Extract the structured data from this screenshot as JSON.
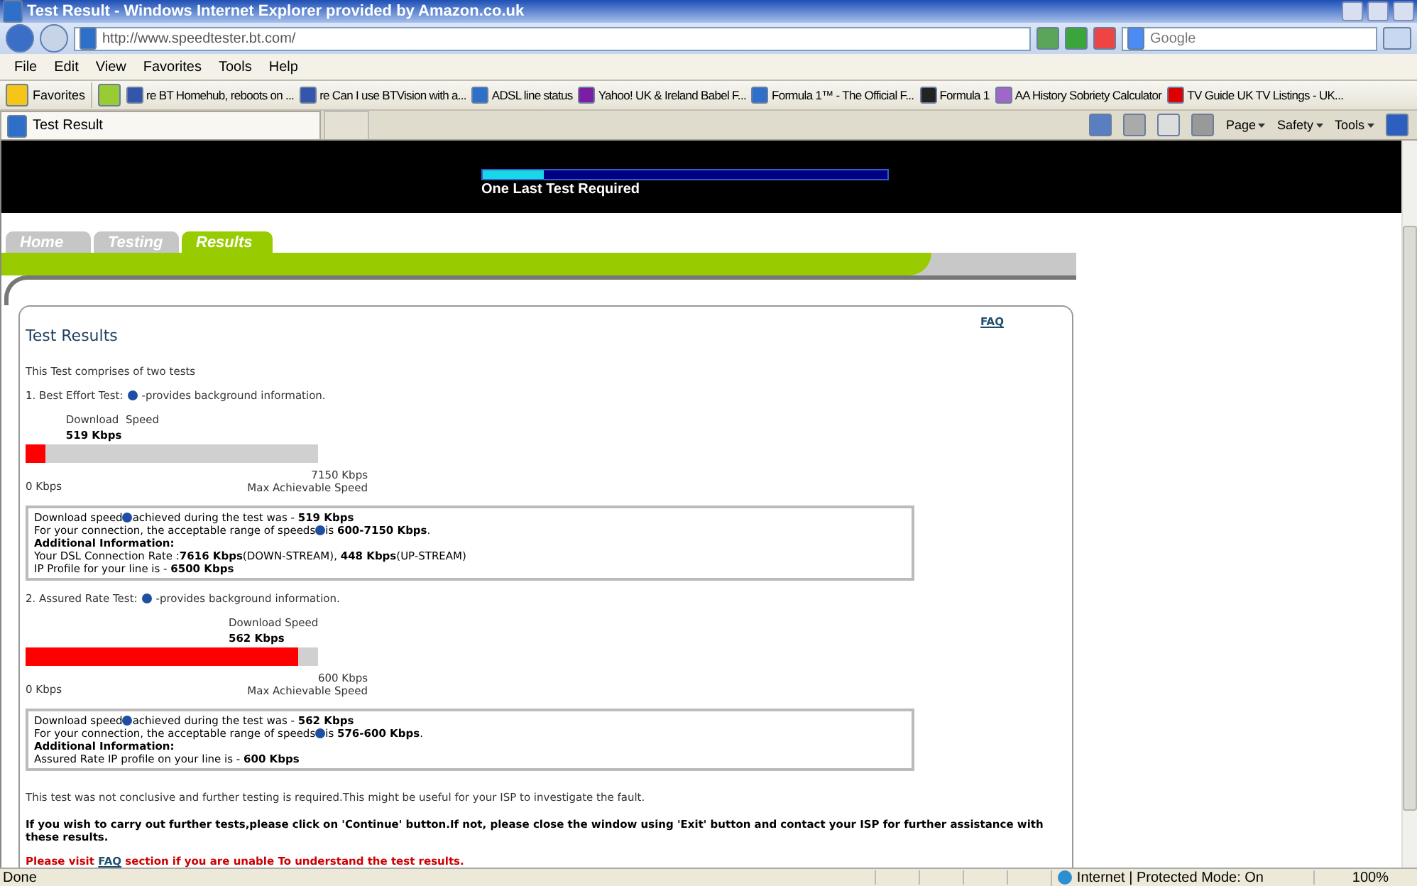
{
  "window": {
    "title": "Test Result - Windows Internet Explorer provided by Amazon.co.uk"
  },
  "browser": {
    "address": "http://www.speedtester.bt.com/",
    "search_placeholder": "Google",
    "menu": [
      "File",
      "Edit",
      "View",
      "Favorites",
      "Tools",
      "Help"
    ],
    "favorites_button": "Favorites",
    "favorites": [
      {
        "label": "re BT Homehub, reboots on ...",
        "kind": "bt"
      },
      {
        "label": "re Can I use BTVision with a...",
        "kind": "bt"
      },
      {
        "label": "ADSL line status",
        "kind": "ie"
      },
      {
        "label": "Yahoo! UK & Ireland Babel F...",
        "kind": "yahoo"
      },
      {
        "label": "Formula 1™ - The Official F...",
        "kind": "ie"
      },
      {
        "label": "Formula 1",
        "kind": "bbc"
      },
      {
        "label": "AA History Sobriety Calculator",
        "kind": "aa"
      },
      {
        "label": "TV Guide UK TV Listings - UK...",
        "kind": "heart"
      }
    ],
    "tab": "Test Result",
    "commands": [
      "Page",
      "Safety",
      "Tools"
    ]
  },
  "page": {
    "progress": {
      "level": 0.15,
      "label": "One Last Test Required"
    },
    "nav_tabs": [
      {
        "label": "Home",
        "selected": false
      },
      {
        "label": "Testing",
        "selected": false
      },
      {
        "label": "Results",
        "selected": true
      }
    ],
    "faq": "FAQ",
    "heading": "Test Results",
    "intro": "This Test comprises of two tests",
    "tests": [
      {
        "title": "1. Best Effort Test:",
        "title_after": "-provides background information.",
        "speed_label": "Download  Speed",
        "speed_value": "519 Kbps",
        "level": 0.07,
        "min_label": "0 Kbps",
        "max_label": "7150 Kbps",
        "max_caption": "Max Achievable Speed",
        "info": [
          {
            "text": "Download speed",
            "after_help": "achieved during the test was - **519 Kbps**"
          },
          {
            "text": "For your connection, the acceptable range of speeds",
            "after_help": "is **600-7150 Kbps**."
          },
          {
            "text": "**Additional Information:**"
          },
          {
            "text": "Your DSL Connection Rate :**7616 Kbps**(DOWN-STREAM), **448 Kbps**(UP-STREAM)"
          },
          {
            "text": "IP Profile for your line is - **6500 Kbps**"
          }
        ]
      },
      {
        "title": "2. Assured Rate Test:",
        "title_after": "-provides background information.",
        "speed_label": "Download Speed",
        "speed_value": "562 Kbps",
        "level": 0.93,
        "min_label": "0 Kbps",
        "max_label": "600 Kbps",
        "max_caption": "Max Achievable Speed",
        "info": [
          {
            "text": "Download speed",
            "after_help": "achieved during the test was - **562 Kbps**"
          },
          {
            "text": "For your connection, the acceptable range of speeds",
            "after_help": "is **576-600 Kbps**."
          },
          {
            "text": "**Additional Information:**"
          },
          {
            "text": "Assured Rate IP profile on your line is - **600 Kbps**"
          }
        ]
      }
    ],
    "note": "This test was not conclusive and further testing is required.This might be useful for your ISP to investigate the fault.",
    "instruction": "If you wish to carry out further tests,please click on 'Continue' button.If not, please close the window using 'Exit' button and contact your ISP for further assistance with these results.",
    "visit": {
      "before": "Please visit",
      "link": "FAQ",
      "after": "section if you are unable To understand the test results."
    }
  },
  "status_bar": {
    "status": "Done",
    "zone": "Internet | Protected Mode: On",
    "zoom": "100%"
  }
}
